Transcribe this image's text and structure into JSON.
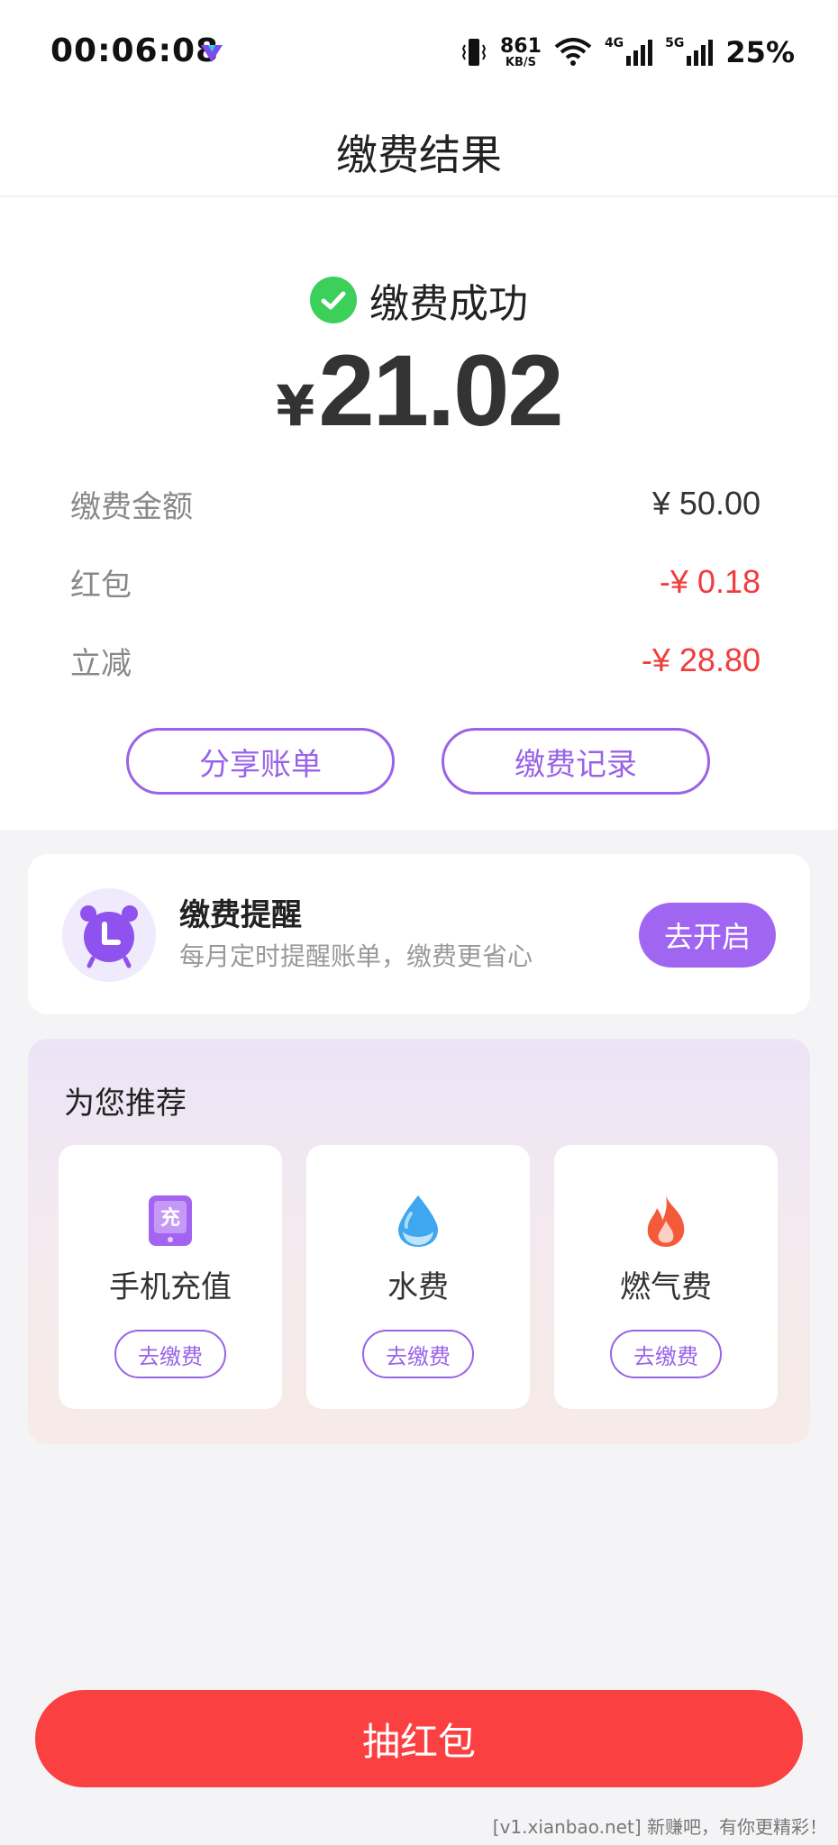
{
  "status_bar": {
    "time": "00:06:08",
    "speed_value": "861",
    "speed_unit": "KB/S",
    "network_4g": "4G",
    "network_5g": "5G",
    "battery": "25%"
  },
  "header": {
    "title": "缴费结果"
  },
  "result": {
    "status_text": "缴费成功",
    "currency_symbol": "¥",
    "amount": "21.02",
    "details": [
      {
        "label": "缴费金额",
        "value": "¥ 50.00",
        "color": "#333333"
      },
      {
        "label": "红包",
        "value": "-¥ 0.18",
        "color": "#f23c3c"
      },
      {
        "label": "立减",
        "value": "-¥ 28.80",
        "color": "#f23c3c"
      }
    ],
    "share_button": "分享账单",
    "records_button": "缴费记录"
  },
  "reminder": {
    "title": "缴费提醒",
    "subtitle": "每月定时提醒账单，缴费更省心",
    "button": "去开启"
  },
  "recommend": {
    "title": "为您推荐",
    "items": [
      {
        "name": "手机充值",
        "button": "去缴费",
        "icon": "phone-recharge-icon"
      },
      {
        "name": "水费",
        "button": "去缴费",
        "icon": "water-drop-icon"
      },
      {
        "name": "燃气费",
        "button": "去缴费",
        "icon": "flame-icon"
      }
    ]
  },
  "draw_button": "抽红包",
  "footer_note": "[v1.xianbao.net] 新赚吧，有你更精彩！",
  "colors": {
    "accent_purple": "#9a63e8",
    "success_green": "#3ccf5a",
    "red": "#fb4041"
  }
}
